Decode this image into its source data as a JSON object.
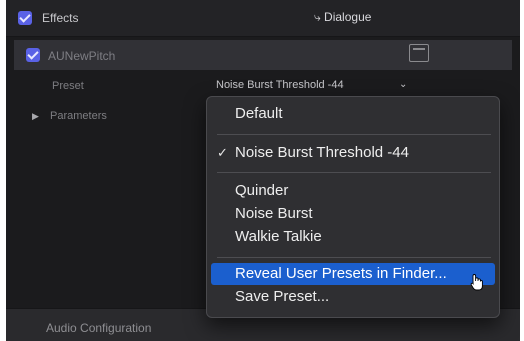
{
  "effects": {
    "label": "Effects",
    "role": "⤷ Dialogue"
  },
  "plugin": {
    "name": "AUNewPitch"
  },
  "preset": {
    "label": "Preset",
    "value": "Noise Burst Threshold -44",
    "chevron": "⌄"
  },
  "parameters": {
    "disclosure": "▶",
    "label": "Parameters"
  },
  "footer": {
    "audio_configuration": "Audio Configuration"
  },
  "menu": {
    "default": "Default",
    "current": {
      "check": "✓",
      "label": "Noise Burst Threshold -44"
    },
    "presets": [
      "Quinder",
      "Noise Burst",
      "Walkie Talkie"
    ],
    "reveal": "Reveal User Presets in Finder...",
    "save": "Save Preset..."
  },
  "colors": {
    "checkbox": "#5a62e6",
    "highlight": "#1b5fce",
    "background": "#1b1b1d"
  }
}
